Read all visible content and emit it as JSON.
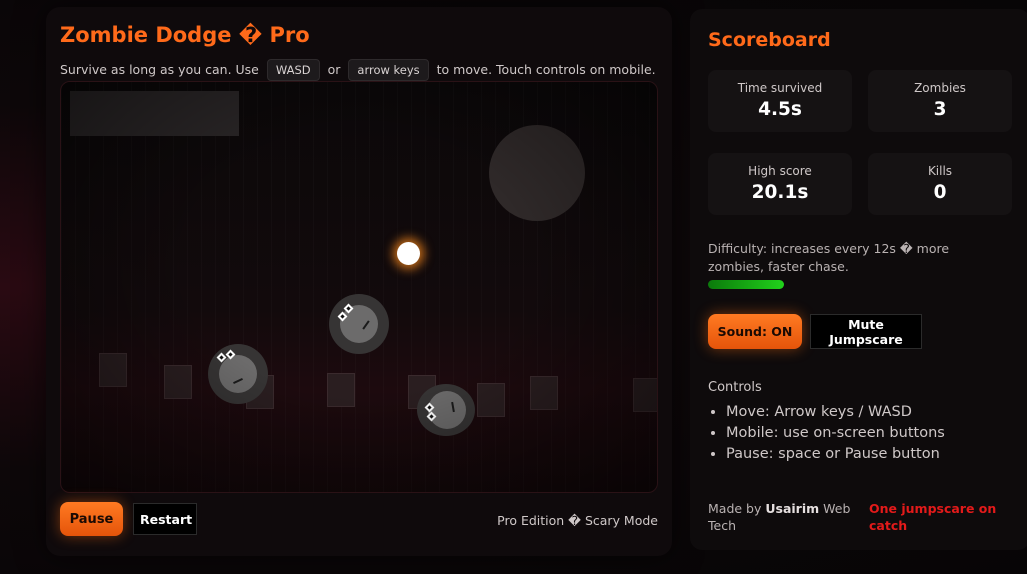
{
  "game": {
    "title": "Zombie Dodge � Pro",
    "subtitle": {
      "text_before": "Survive as long as you can. Use",
      "key1": "WASD",
      "text_or": "or",
      "key2": "arrow keys",
      "text_after": "to move. Touch controls on mobile."
    },
    "pause_label": "Pause",
    "restart_label": "Restart",
    "edition_label": "Pro Edition � Scary Mode"
  },
  "scoreboard": {
    "title": "Scoreboard",
    "stats": [
      {
        "label": "Time survived",
        "value": "4.5s"
      },
      {
        "label": "Zombies",
        "value": "3"
      },
      {
        "label": "High score",
        "value": "20.1s"
      },
      {
        "label": "Kills",
        "value": "0"
      }
    ],
    "difficulty_text": "Difficulty: increases every 12s � more zombies, faster chase.",
    "sound_label": "Sound: ON",
    "mute_label": "Mute Jumpscare",
    "controls_title": "Controls",
    "controls": [
      "Move: Arrow keys / WASD",
      "Mobile: use on-screen buttons",
      "Pause: space or Pause button"
    ],
    "credit": {
      "prefix": "Made by",
      "name": "Usairim",
      "suffix": "Web Tech"
    },
    "warning": "One jumpscare on catch"
  },
  "colors": {
    "accent": "#ff6a1a",
    "warning": "#e31a1a",
    "difficulty_bar": "#21d21b"
  }
}
